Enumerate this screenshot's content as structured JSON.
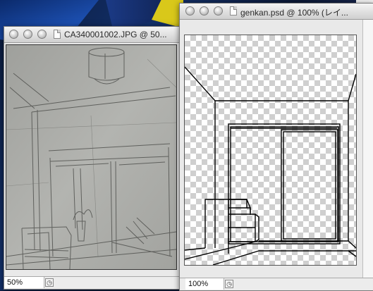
{
  "left_window": {
    "title": "CA340001002.JPG @ 50...",
    "zoom": "50%"
  },
  "right_window": {
    "title": "genkan.psd @ 100% (レイ...",
    "zoom": "100%"
  },
  "icons": {
    "close": "close-icon",
    "minimize": "minimize-icon",
    "zoom": "zoom-icon",
    "document": "document-icon",
    "status_menu": "status-arrow-icon"
  },
  "colors": {
    "titlebar": "#dcdcdc",
    "sketch_paper": "#a9aaa6",
    "checker": "#cfcfcf"
  }
}
